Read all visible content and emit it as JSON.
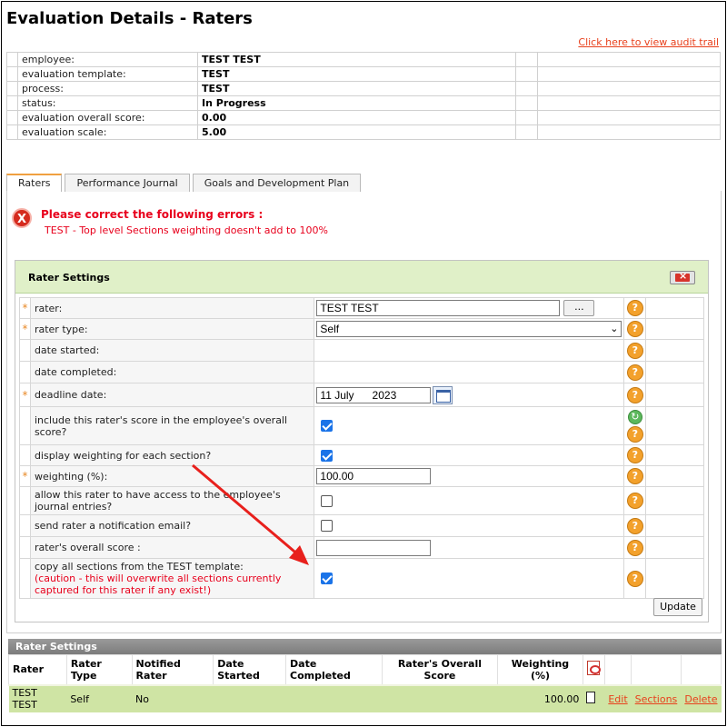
{
  "page": {
    "title": "Evaluation Details - Raters",
    "audit_link": "Click here to view audit trail"
  },
  "info": [
    {
      "label": "employee:",
      "value": "TEST TEST"
    },
    {
      "label": "evaluation template:",
      "value": "TEST"
    },
    {
      "label": "process:",
      "value": "TEST"
    },
    {
      "label": "status:",
      "value": "In Progress"
    },
    {
      "label": "evaluation overall score:",
      "value": "0.00"
    },
    {
      "label": "evaluation scale:",
      "value": "5.00"
    }
  ],
  "tabs": [
    "Raters",
    "Performance Journal",
    "Goals and Development Plan"
  ],
  "errors": {
    "title": "Please correct the following errors :",
    "message": "TEST - Top level Sections weighting doesn't add to 100%",
    "icon_symbol": "X"
  },
  "rater_settings": {
    "title": "Rater Settings",
    "close_symbol": "×",
    "required_mark": "*",
    "help_symbol": "?",
    "refresh_symbol": "↻",
    "browse_label": "...",
    "update_label": "Update",
    "fields": {
      "rater": {
        "label": "rater:",
        "value": "TEST TEST"
      },
      "rater_type": {
        "label": "rater type:",
        "value": "Self",
        "chevron": "⌄"
      },
      "date_started": {
        "label": "date started:"
      },
      "date_completed": {
        "label": "date completed:"
      },
      "deadline_date": {
        "label": "deadline date:",
        "value": "11 July      2023"
      },
      "include_score": {
        "label": "include this rater's score in the employee's overall score?",
        "checked": true
      },
      "display_weighting": {
        "label": "display weighting for each section?",
        "checked": true
      },
      "weighting": {
        "label": "weighting (%):",
        "value": "100.00"
      },
      "journal_access": {
        "label": "allow this rater to have access to the employee's journal entries?",
        "checked": false
      },
      "notification": {
        "label": "send rater a notification email?",
        "checked": false
      },
      "overall_score": {
        "label": "rater's overall score :",
        "value": ""
      },
      "copy_sections": {
        "label": "copy all sections from the TEST template:",
        "caution": "(caution - this will overwrite all sections currently captured for this rater if any exist!)",
        "checked": true
      }
    }
  },
  "grid": {
    "title": "Rater Settings",
    "headers": [
      "Rater",
      "Rater Type",
      "Notified Rater",
      "Date Started",
      "Date Completed",
      "Rater's Overall Score",
      "Weighting (%)"
    ],
    "rows": [
      {
        "rater": "TEST TEST",
        "type": "Self",
        "notified": "No",
        "started": "",
        "completed": "",
        "score": "",
        "weighting": "100.00",
        "actions": [
          "Edit",
          "Sections",
          "Delete"
        ]
      }
    ]
  },
  "colors": {
    "accent": "#f0a040",
    "error": "#e8001c",
    "link": "#e8401c",
    "panel_header": "#e0f0c8",
    "row_green": "#cfe4a4"
  }
}
